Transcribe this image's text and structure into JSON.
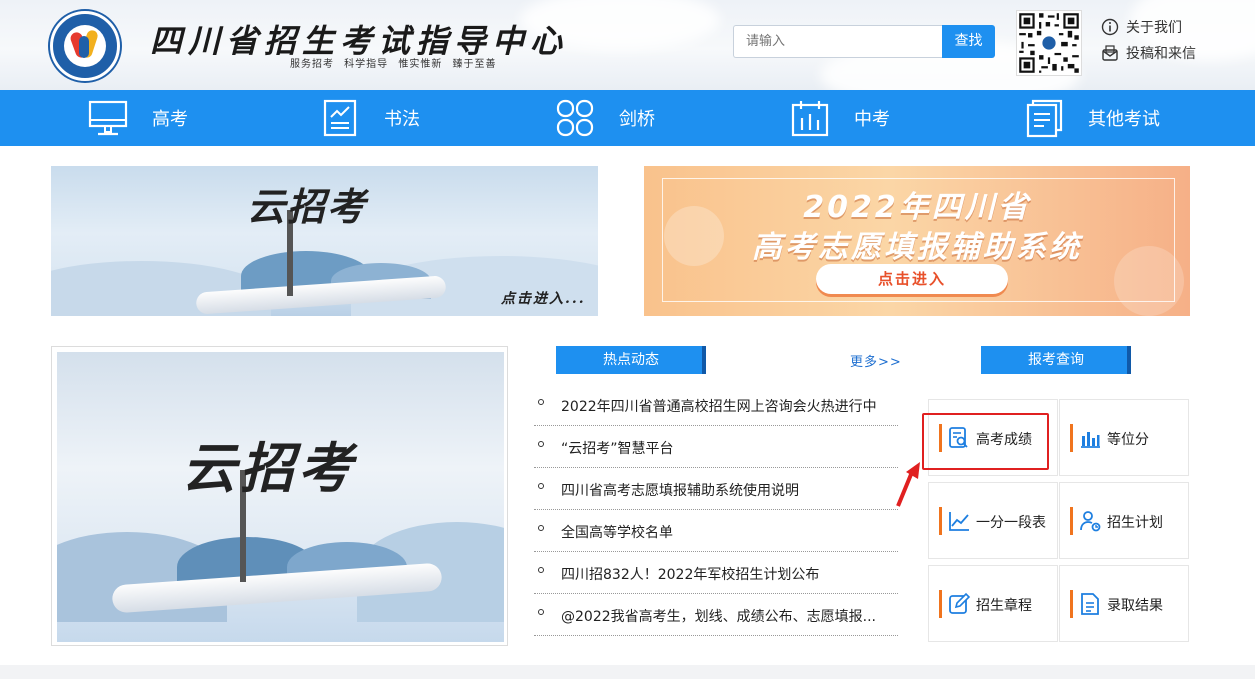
{
  "header": {
    "site_title": "四川省招生考试指导中心",
    "slogan": "服务招考 科学指导 惟实惟新 臻于至善",
    "search_placeholder": "请输入",
    "search_button": "查找",
    "about_label": "关于我们",
    "contact_label": "投稿和来信",
    "about_icon": "info-icon",
    "contact_icon": "mail-icon"
  },
  "nav": {
    "items": [
      {
        "label": "高考",
        "icon": "monitor-icon"
      },
      {
        "label": "书法",
        "icon": "document-edit-icon"
      },
      {
        "label": "剑桥",
        "icon": "grid-circles-icon"
      },
      {
        "label": "中考",
        "icon": "bar-building-icon"
      },
      {
        "label": "其他考试",
        "icon": "document-list-icon"
      }
    ],
    "color": "#1e90f0"
  },
  "banners": {
    "left": {
      "title": "云招考",
      "caption": "点击进入..."
    },
    "right": {
      "line1": "2022年四川省",
      "line2": "高考志愿填报辅助系统",
      "button": "点击进入"
    }
  },
  "feature": {
    "title": "云招考"
  },
  "hot_news": {
    "tab_label": "热点动态",
    "more_label": "更多>>",
    "items": [
      "2022年四川省普通高校招生网上咨询会火热进行中",
      "“云招考”智慧平台",
      "四川省高考志愿填报辅助系统使用说明",
      "全国高等学校名单",
      "四川招832人！2022年军校招生计划公布",
      "@2022我省高考生，划线、成绩公布、志愿填报..."
    ]
  },
  "query": {
    "tab_label": "报考查询",
    "items": [
      {
        "label": "高考成绩",
        "icon": "search-doc-icon"
      },
      {
        "label": "等位分",
        "icon": "bar-chart-icon"
      },
      {
        "label": "一分一段表",
        "icon": "line-chart-icon"
      },
      {
        "label": "招生计划",
        "icon": "user-plan-icon"
      },
      {
        "label": "招生章程",
        "icon": "edit-icon"
      },
      {
        "label": "录取结果",
        "icon": "file-icon"
      }
    ],
    "accent_color": "#f0741e",
    "highlight_color": "#e02020"
  }
}
